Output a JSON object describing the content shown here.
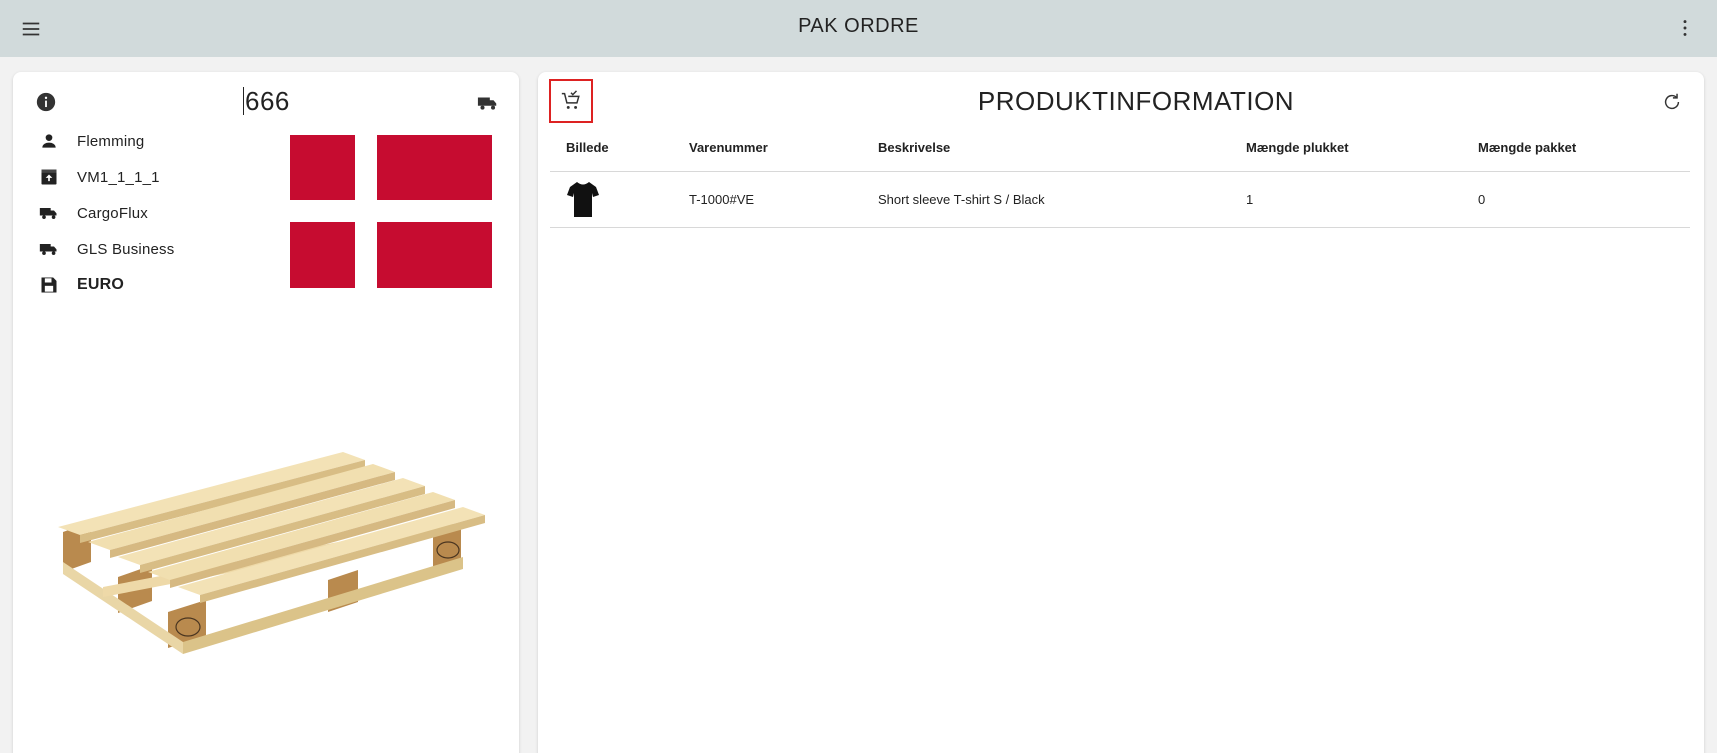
{
  "header": {
    "title": "PAK ORDRE",
    "menu_icon": "menu-icon",
    "more_icon": "more-vert-icon",
    "background": "#d1dadb"
  },
  "order": {
    "number": "666",
    "info_icon": "info-icon",
    "shipping_icon": "truck-icon",
    "details": [
      {
        "icon": "person-icon",
        "label": "Flemming",
        "bold": false
      },
      {
        "icon": "archive-upload-icon",
        "label": "VM1_1_1_1",
        "bold": false
      },
      {
        "icon": "truck-icon",
        "label": "CargoFlux",
        "bold": false
      },
      {
        "icon": "truck-icon",
        "label": "GLS Business",
        "bold": false
      },
      {
        "icon": "save-icon",
        "label": "EURO",
        "bold": true
      }
    ],
    "flag": "denmark-flag",
    "flag_color": "#c60c30",
    "packaging_image": "euro-pallet"
  },
  "products": {
    "title": "PRODUKTINFORMATION",
    "cart_icon": "cart-check-icon",
    "refresh_icon": "refresh-icon",
    "highlight_color": "#dd2222",
    "columns": [
      "Billede",
      "Varenummer",
      "Beskrivelse",
      "Mængde plukket",
      "Mængde pakket"
    ],
    "rows": [
      {
        "image": "black-tshirt",
        "sku": "T-1000#VE",
        "description": "Short sleeve T-shirt S / Black",
        "picked": "1",
        "packed": "0"
      }
    ]
  }
}
